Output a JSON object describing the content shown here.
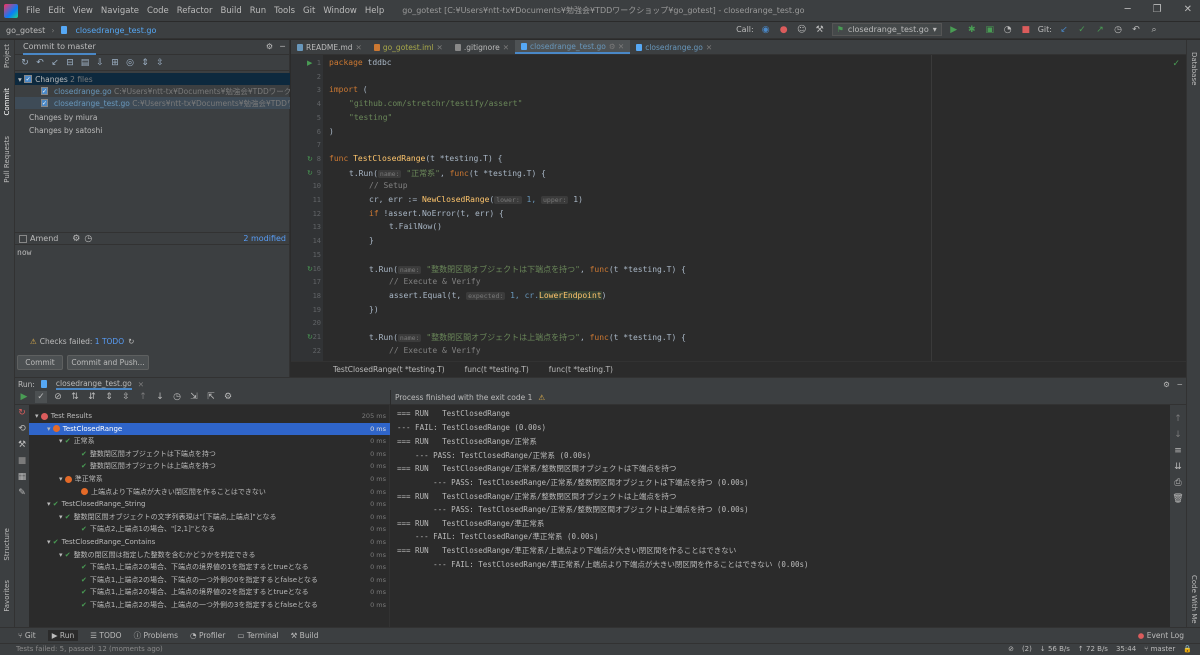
{
  "menubar": {
    "items": [
      "File",
      "Edit",
      "View",
      "Navigate",
      "Code",
      "Refactor",
      "Build",
      "Run",
      "Tools",
      "Git",
      "Window",
      "Help"
    ],
    "window_title": "go_gotest [C:¥Users¥ntt-tx¥Documents¥勉強会¥TDDワークショップ¥go_gotest] - closedrange_test.go"
  },
  "navbar": {
    "project": "go_gotest",
    "file": "closedrange_test.go",
    "call_label": "Call:",
    "run_config": "closedrange_test.go",
    "git_label": "Git:"
  },
  "left_strip": {
    "project": "Project",
    "commit": "Commit",
    "pull_requests": "Pull Requests",
    "structure": "Structure",
    "favorites": "Favorites"
  },
  "right_strip": {
    "database": "Database",
    "code_with_me": "Code With Me"
  },
  "commit": {
    "tab": "Commit to master",
    "changes_label": "Changes",
    "changes_count": "2 files",
    "files": [
      {
        "name": "closedrange.go",
        "path": "C:¥Users¥ntt-tx¥Documents¥勉強会¥TDDワークショップ"
      },
      {
        "name": "closedrange_test.go",
        "path": "C:¥Users¥ntt-tx¥Documents¥勉強会¥TDDワーク"
      }
    ],
    "groups": [
      "Changes by miura",
      "Changes by satoshi"
    ],
    "amend": "Amend",
    "modified": "2 modified",
    "message": "now",
    "checks_failed": "Checks failed:",
    "todo": "1 TODO",
    "commit_btn": "Commit",
    "commit_push_btn": "Commit and Push..."
  },
  "editor": {
    "tabs": [
      "README.md",
      "go_gotest.iml",
      ".gitignore",
      "closedrange_test.go",
      "closedrange.go"
    ],
    "line_numbers": [
      "1",
      "2",
      "3",
      "4",
      "5",
      "6",
      "7",
      "8",
      "9",
      "10",
      "11",
      "12",
      "13",
      "14",
      "15",
      "16",
      "17",
      "18",
      "19",
      "20",
      "21",
      "22"
    ],
    "breadcrumbs": [
      "TestClosedRange(t *testing.T)",
      "func(t *testing.T)",
      "func(t *testing.T)"
    ],
    "code": {
      "l1a": "package",
      "l1b": " tddbc",
      "l3a": "import",
      "l3b": " (",
      "l4": "\"github.com/stretchr/testify/assert\"",
      "l5": "\"testing\"",
      "l6": ")",
      "l8a": "func",
      "l8b": "TestClosedRange",
      "l8c": "(t *testing.T) {",
      "l9a": "t.Run(",
      "l9h": "name:",
      "l9s": "\"正常系\"",
      "l9b": ", ",
      "l9k": "func",
      "l9c": "(t *testing.T) {",
      "l10": "// Setup",
      "l11a": "cr, err := ",
      "l11f": "NewClosedRange",
      "l11b": "(",
      "l11h1": "lower:",
      "l11c": " 1, ",
      "l11h2": "upper:",
      "l11d": " 1)",
      "l12a": "if",
      "l12b": " !assert.NoError(t, err) {",
      "l13": "t.FailNow()",
      "l14": "}",
      "l16a": "t.Run(",
      "l16h": "name:",
      "l16s": "\"整数閉区間オブジェクトは下端点を持つ\"",
      "l16b": ", ",
      "l16k": "func",
      "l16c": "(t *testing.T) {",
      "l17": "// Execute & Verify",
      "l18a": "assert.Equal(t, ",
      "l18h": "expected:",
      "l18b": " 1, cr.",
      "l18f": "LowerEndpoint",
      "l18c": ")",
      "l19": "})",
      "l21a": "t.Run(",
      "l21h": "name:",
      "l21s": "\"整数閉区間オブジェクトは上端点を持つ\"",
      "l21b": ", ",
      "l21k": "func",
      "l21c": "(t *testing.T) {",
      "l22": "// Execute & Verify"
    }
  },
  "run": {
    "label": "Run:",
    "tab": "closedrange_test.go",
    "root": "Test Results",
    "root_time": "205 ms",
    "tests": [
      {
        "label": "TestClosedRange",
        "time": "0 ms",
        "status": "fail"
      },
      {
        "label": "正常系",
        "time": "0 ms",
        "status": "pass"
      },
      {
        "label": "整数閉区間オブジェクトは下端点を持つ",
        "time": "0 ms",
        "status": "pass"
      },
      {
        "label": "整数閉区間オブジェクトは上端点を持つ",
        "time": "0 ms",
        "status": "pass"
      },
      {
        "label": "準正常系",
        "time": "0 ms",
        "status": "fail"
      },
      {
        "label": "上端点より下端点が大きい閉区間を作ることはできない",
        "time": "0 ms",
        "status": "fail"
      },
      {
        "label": "TestClosedRange_String",
        "time": "0 ms",
        "status": "pass"
      },
      {
        "label": "整数閉区間オブジェクトの文字列表現は\"[下端点,上端点]\"となる",
        "time": "0 ms",
        "status": "pass"
      },
      {
        "label": "下端点2,上端点1の場合、\"[2,1]\"となる",
        "time": "0 ms",
        "status": "pass"
      },
      {
        "label": "TestClosedRange_Contains",
        "time": "0 ms",
        "status": "pass"
      },
      {
        "label": "整数の閉区間は指定した整数を含むかどうかを判定できる",
        "time": "0 ms",
        "status": "pass"
      },
      {
        "label": "下端点1,上端点2の場合、下端点の境界値の1を指定するとtrueとなる",
        "time": "0 ms",
        "status": "pass"
      },
      {
        "label": "下端点1,上端点2の場合、下端点の一つ外側の0を指定するとfalseとなる",
        "time": "0 ms",
        "status": "pass"
      },
      {
        "label": "下端点1,上端点2の場合、上端点の境界値の2を指定するとtrueとなる",
        "time": "0 ms",
        "status": "pass"
      },
      {
        "label": "下端点1,上端点2の場合、上端点の一つ外側の3を指定するとfalseとなる",
        "time": "0 ms",
        "status": "pass"
      }
    ],
    "process_status": "Process finished with the exit code 1",
    "output": [
      "=== RUN   TestClosedRange",
      "--- FAIL: TestClosedRange (0.00s)",
      "=== RUN   TestClosedRange/正常系",
      "    --- PASS: TestClosedRange/正常系 (0.00s)",
      "=== RUN   TestClosedRange/正常系/整数閉区間オブジェクトは下端点を持つ",
      "        --- PASS: TestClosedRange/正常系/整数閉区間オブジェクトは下端点を持つ (0.00s)",
      "=== RUN   TestClosedRange/正常系/整数閉区間オブジェクトは上端点を持つ",
      "        --- PASS: TestClosedRange/正常系/整数閉区間オブジェクトは上端点を持つ (0.00s)",
      "=== RUN   TestClosedRange/準正常系",
      "    --- FAIL: TestClosedRange/準正常系 (0.00s)",
      "=== RUN   TestClosedRange/準正常系/上端点より下端点が大きい閉区間を作ることはできない",
      "        --- FAIL: TestClosedRange/準正常系/上端点より下端点が大きい閉区間を作ることはできない (0.00s)"
    ]
  },
  "bottombar": {
    "git": "Git",
    "run": "Run",
    "todo": "TODO",
    "problems": "Problems",
    "profiler": "Profiler",
    "terminal": "Terminal",
    "build": "Build",
    "event_log": "Event Log"
  },
  "status": {
    "left": "Tests failed: 5, passed: 12 (moments ago)",
    "count": "(2)",
    "down": "56 B/s",
    "up": "72 B/s",
    "position": "35:44",
    "branch": "master"
  }
}
